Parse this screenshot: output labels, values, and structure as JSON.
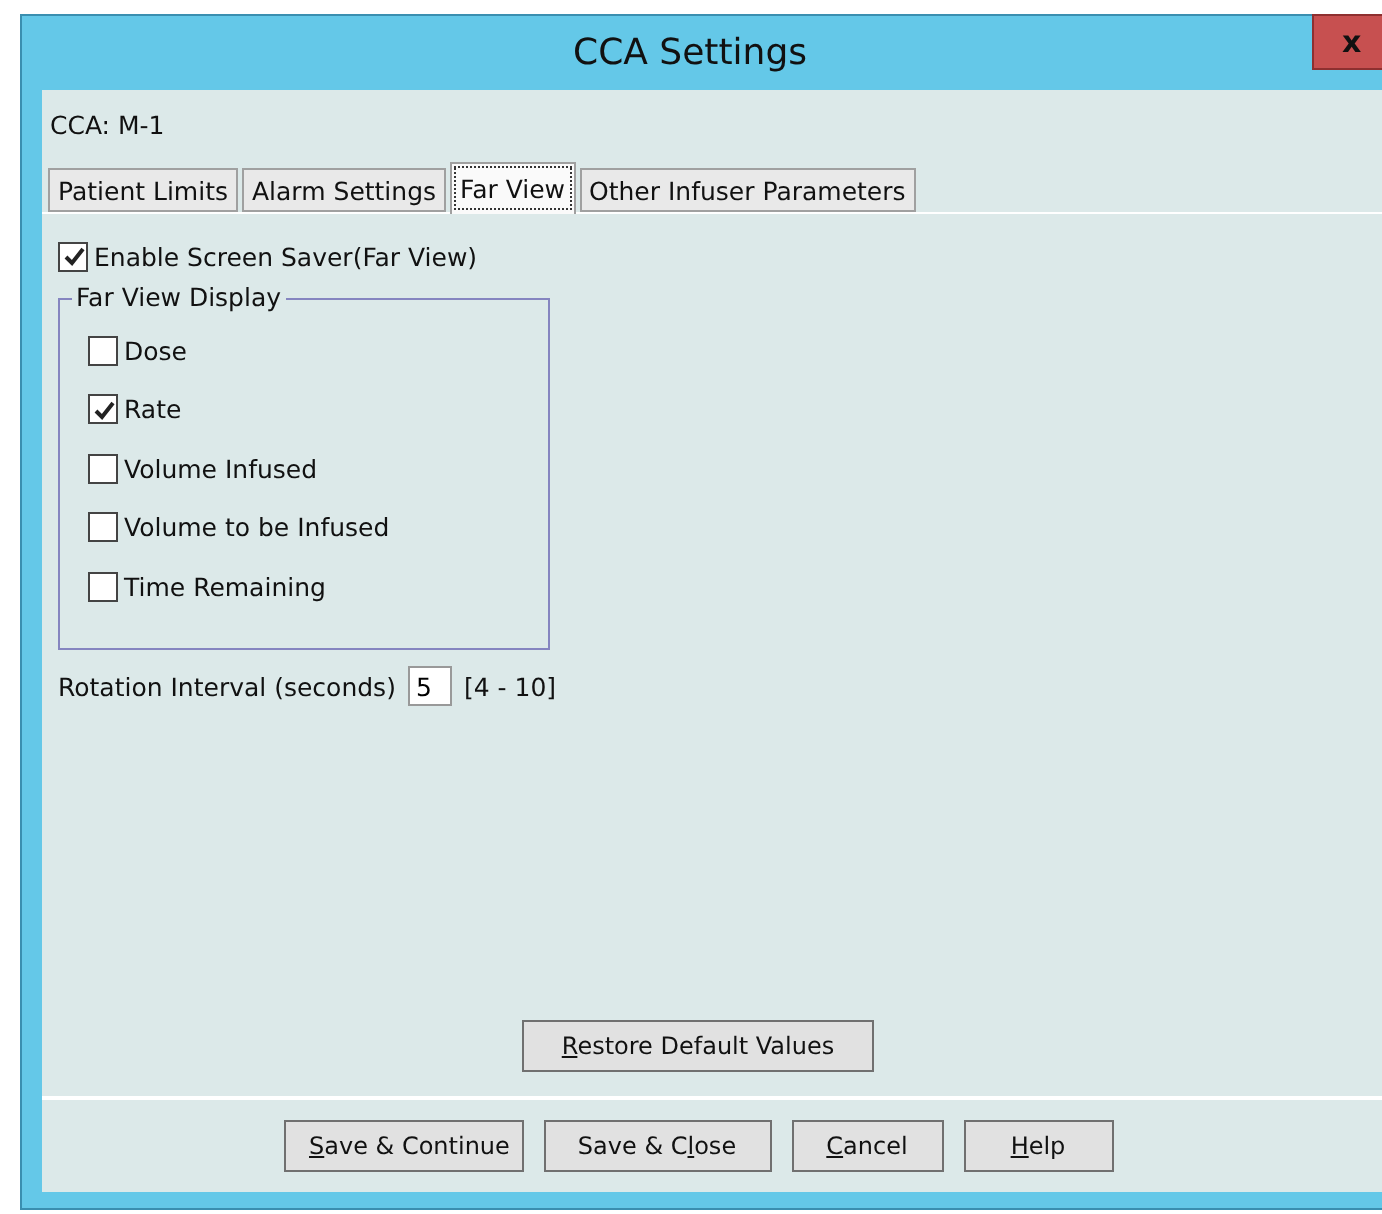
{
  "window": {
    "title": "CCA Settings",
    "close": "x"
  },
  "cca_label": "CCA: M-1",
  "tabs": [
    {
      "label": "Patient Limits",
      "selected": false
    },
    {
      "label": "Alarm Settings",
      "selected": false
    },
    {
      "label": "Far View",
      "selected": true
    },
    {
      "label": "Other Infuser Parameters",
      "selected": false
    }
  ],
  "enable_screen_saver": {
    "label": "Enable Screen Saver(Far View)",
    "checked": true
  },
  "far_view_display": {
    "title": "Far View Display",
    "options": [
      {
        "label": "Dose",
        "checked": false
      },
      {
        "label": "Rate",
        "checked": true
      },
      {
        "label": "Volume Infused",
        "checked": false
      },
      {
        "label": "Volume to be Infused",
        "checked": false
      },
      {
        "label": "Time Remaining",
        "checked": false
      }
    ]
  },
  "rotation_interval": {
    "label": "Rotation Interval (seconds)",
    "value": "5",
    "range": "[4 - 10]"
  },
  "restore_button": {
    "key": "R",
    "after": "estore Default Values"
  },
  "buttons": [
    {
      "key": "S",
      "after": "ave & Continue"
    },
    {
      "before": "Save & C",
      "key": "l",
      "after": "ose"
    },
    {
      "key": "C",
      "after": "ancel"
    },
    {
      "key": "H",
      "after": "elp"
    }
  ]
}
